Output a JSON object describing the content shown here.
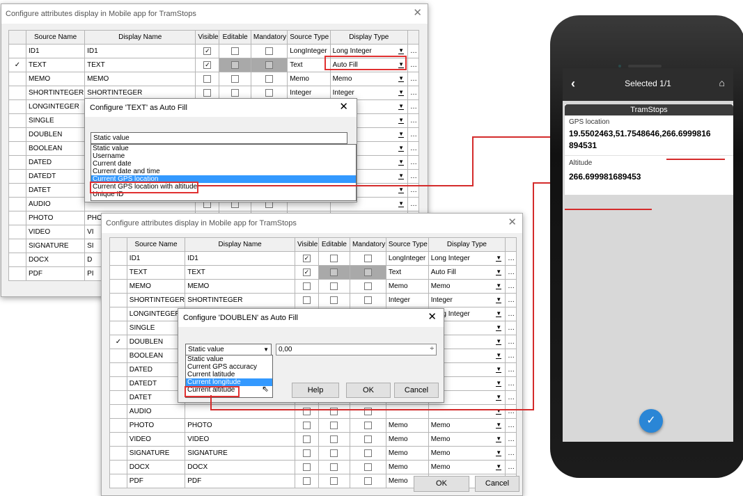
{
  "dialog1": {
    "title": "Configure attributes display in Mobile app for TramStops",
    "columns": [
      "",
      "Source Name",
      "Display Name",
      "Visible",
      "Editable",
      "Mandatory",
      "Source Type",
      "Display Type",
      ""
    ],
    "rows": [
      {
        "src": "ID1",
        "disp": "ID1",
        "visible": true,
        "grey": false,
        "stype": "LongInteger",
        "dtype": "Long Integer",
        "marker": ""
      },
      {
        "src": "TEXT",
        "disp": "TEXT",
        "visible": true,
        "grey": true,
        "stype": "Text",
        "dtype": "Auto Fill",
        "marker": "✓"
      },
      {
        "src": "MEMO",
        "disp": "MEMO",
        "visible": false,
        "grey": false,
        "stype": "Memo",
        "dtype": "Memo",
        "marker": ""
      },
      {
        "src": "SHORTINTEGER",
        "disp": "SHORTINTEGER",
        "visible": false,
        "grey": false,
        "stype": "Integer",
        "dtype": "Integer",
        "marker": ""
      },
      {
        "src": "LONGINTEGER",
        "disp": "",
        "visible": false,
        "grey": false,
        "stype": "",
        "dtype": "teger",
        "marker": ""
      },
      {
        "src": "SINGLE",
        "disp": "",
        "visible": false,
        "grey": false,
        "stype": "",
        "dtype": "",
        "marker": ""
      },
      {
        "src": "DOUBLEN",
        "disp": "",
        "visible": false,
        "grey": false,
        "stype": "",
        "dtype": "",
        "marker": ""
      },
      {
        "src": "BOOLEAN",
        "disp": "",
        "visible": false,
        "grey": false,
        "stype": "",
        "dtype": "",
        "marker": ""
      },
      {
        "src": "DATED",
        "disp": "",
        "visible": false,
        "grey": false,
        "stype": "",
        "dtype": "",
        "marker": ""
      },
      {
        "src": "DATEDT",
        "disp": "",
        "visible": false,
        "grey": false,
        "stype": "",
        "dtype": "",
        "marker": ""
      },
      {
        "src": "DATET",
        "disp": "",
        "visible": false,
        "grey": false,
        "stype": "",
        "dtype": "",
        "marker": ""
      },
      {
        "src": "AUDIO",
        "disp": "",
        "visible": false,
        "grey": false,
        "stype": "",
        "dtype": "",
        "marker": ""
      },
      {
        "src": "PHOTO",
        "disp": "PHOTO",
        "visible": false,
        "grey": false,
        "stype": "Memo",
        "dtype": "Memo",
        "marker": ""
      },
      {
        "src": "VIDEO",
        "disp": "VI",
        "visible": false,
        "grey": false,
        "stype": "",
        "dtype": "",
        "marker": ""
      },
      {
        "src": "SIGNATURE",
        "disp": "SI",
        "visible": false,
        "grey": false,
        "stype": "",
        "dtype": "",
        "marker": ""
      },
      {
        "src": "DOCX",
        "disp": "D",
        "visible": false,
        "grey": false,
        "stype": "",
        "dtype": "",
        "marker": ""
      },
      {
        "src": "PDF",
        "disp": "PI",
        "visible": false,
        "grey": false,
        "stype": "",
        "dtype": "",
        "marker": ""
      }
    ]
  },
  "autofill1": {
    "title": "Configure 'TEXT' as Auto Fill",
    "selected": "Static value",
    "options": [
      "Static value",
      "Username",
      "Current date",
      "Current date and time",
      "Current GPS location",
      "Current GPS location with altitude",
      "Unique ID"
    ],
    "highlighted_index": 4
  },
  "dialog2": {
    "title": "Configure attributes display in Mobile app for TramStops",
    "columns": [
      "",
      "Source Name",
      "Display Name",
      "Visible",
      "Editable",
      "Mandatory",
      "Source Type",
      "Display Type",
      ""
    ],
    "rows": [
      {
        "src": "ID1",
        "disp": "ID1",
        "visible": true,
        "grey": false,
        "stype": "LongInteger",
        "dtype": "Long Integer",
        "marker": ""
      },
      {
        "src": "TEXT",
        "disp": "TEXT",
        "visible": true,
        "grey": true,
        "stype": "Text",
        "dtype": "Auto Fill",
        "marker": ""
      },
      {
        "src": "MEMO",
        "disp": "MEMO",
        "visible": false,
        "grey": false,
        "stype": "Memo",
        "dtype": "Memo",
        "marker": ""
      },
      {
        "src": "SHORTINTEGER",
        "disp": "SHORTINTEGER",
        "visible": false,
        "grey": false,
        "stype": "Integer",
        "dtype": "Integer",
        "marker": ""
      },
      {
        "src": "LONGINTEGER",
        "disp": "LONGINTEGER",
        "visible": false,
        "grey": false,
        "stype": "LongInteger",
        "dtype": "Long Integer",
        "marker": ""
      },
      {
        "src": "SINGLE",
        "disp": "",
        "visible": false,
        "grey": false,
        "stype": "",
        "dtype": "",
        "marker": ""
      },
      {
        "src": "DOUBLEN",
        "disp": "",
        "visible": false,
        "grey": false,
        "stype": "",
        "dtype": "",
        "marker": "✓"
      },
      {
        "src": "BOOLEAN",
        "disp": "",
        "visible": false,
        "grey": false,
        "stype": "",
        "dtype": "n",
        "marker": ""
      },
      {
        "src": "DATED",
        "disp": "",
        "visible": false,
        "grey": false,
        "stype": "",
        "dtype": "",
        "marker": ""
      },
      {
        "src": "DATEDT",
        "disp": "",
        "visible": false,
        "grey": false,
        "stype": "",
        "dtype": "ne",
        "marker": ""
      },
      {
        "src": "DATET",
        "disp": "",
        "visible": false,
        "grey": false,
        "stype": "",
        "dtype": "",
        "marker": ""
      },
      {
        "src": "AUDIO",
        "disp": "",
        "visible": false,
        "grey": false,
        "stype": "",
        "dtype": "",
        "marker": ""
      },
      {
        "src": "PHOTO",
        "disp": "PHOTO",
        "visible": false,
        "grey": false,
        "stype": "Memo",
        "dtype": "Memo",
        "marker": ""
      },
      {
        "src": "VIDEO",
        "disp": "VIDEO",
        "visible": false,
        "grey": false,
        "stype": "Memo",
        "dtype": "Memo",
        "marker": ""
      },
      {
        "src": "SIGNATURE",
        "disp": "SIGNATURE",
        "visible": false,
        "grey": false,
        "stype": "Memo",
        "dtype": "Memo",
        "marker": ""
      },
      {
        "src": "DOCX",
        "disp": "DOCX",
        "visible": false,
        "grey": false,
        "stype": "Memo",
        "dtype": "Memo",
        "marker": ""
      },
      {
        "src": "PDF",
        "disp": "PDF",
        "visible": false,
        "grey": false,
        "stype": "Memo",
        "dtype": "Memo",
        "marker": ""
      }
    ],
    "ok_label": "OK",
    "cancel_label": "Cancel"
  },
  "autofill2": {
    "title": "Configure 'DOUBLEN' as Auto Fill",
    "selected": "Static value",
    "value": "0,00",
    "options": [
      "Static value",
      "Current GPS accuracy",
      "Current latitude",
      "Current longitude",
      "Current altitude"
    ],
    "highlighted_index": 3,
    "help_label": "Help",
    "ok_label": "OK",
    "cancel_label": "Cancel"
  },
  "phone": {
    "header_title": "Selected 1/1",
    "card_title": "TramStops",
    "gps_label": "GPS location",
    "gps_value_line1": "19.5502463,51.7548646,266.6999816",
    "gps_value_line2": "894531",
    "alt_label": "Altitude",
    "alt_value": "266.699981689453",
    "accent_color": "#2a86d6"
  },
  "colors": {
    "annotation_red": "#d42b2b",
    "selection_blue": "#3399ff"
  }
}
